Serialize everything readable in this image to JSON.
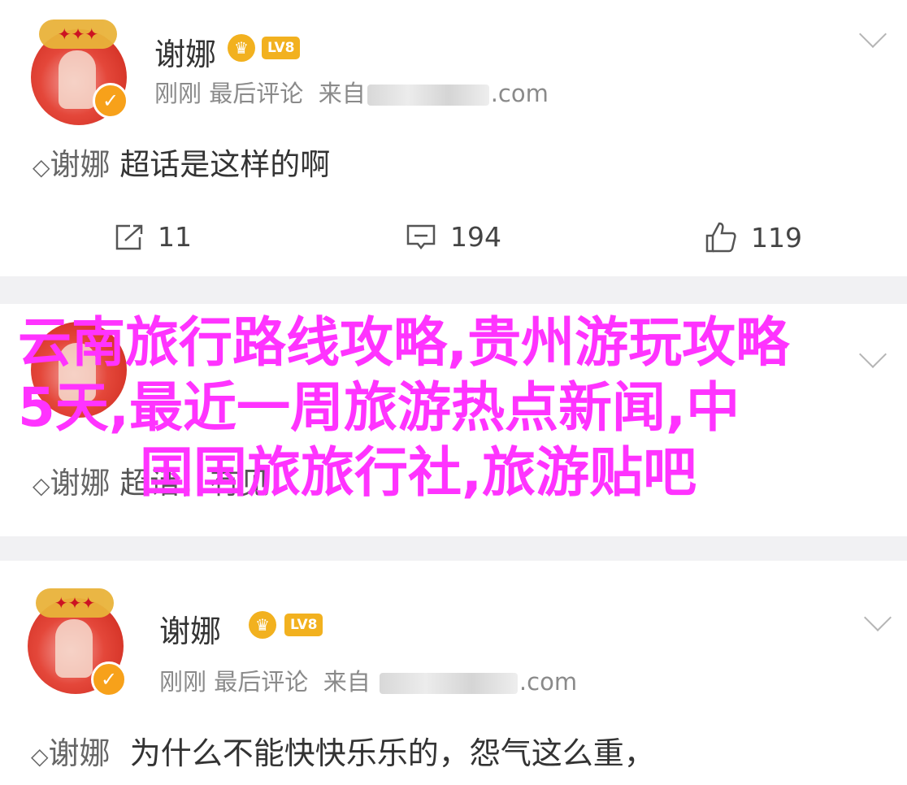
{
  "posts": [
    {
      "username": "谢娜",
      "level_badge": "LV8",
      "meta_time": "刚刚",
      "meta_action": "最后评论",
      "meta_from": "来自",
      "meta_domain": ".com",
      "topic_tag": "谢娜",
      "content": "超话是这样的啊",
      "share_count": "11",
      "comment_count": "194",
      "like_count": "119"
    },
    {
      "topic_tag": "谢娜",
      "content": "超话，有见"
    },
    {
      "username": "谢娜",
      "level_badge": "LV8",
      "meta_time": "刚刚",
      "meta_action": "最后评论",
      "meta_from": "来自",
      "meta_domain": ".com",
      "topic_tag": "谢娜",
      "content": "为什么不能快快乐乐的，怨气这么重，"
    }
  ],
  "overlay": {
    "line1": "云南旅行路线攻略,贵州游玩攻略",
    "line2": "5天,最近一周旅游热点新闻,中",
    "line3": "国国旅旅行社,旅游贴吧",
    "color": "#ff33ff"
  },
  "icons": [
    "chevron-down-icon",
    "diamond-topic-icon",
    "share-icon",
    "comment-icon",
    "like-icon",
    "verified-icon",
    "crown-badge-icon"
  ]
}
